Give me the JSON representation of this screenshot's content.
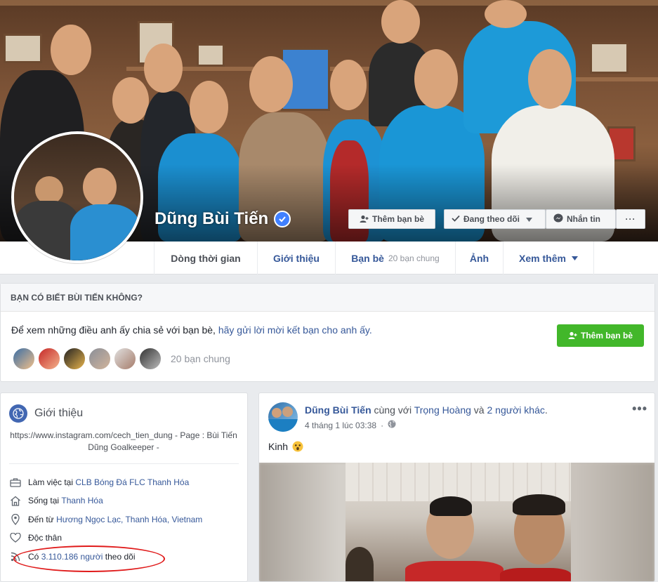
{
  "profile": {
    "name": "Dũng Bùi Tiến"
  },
  "cover_actions": {
    "add_friend": "Thêm bạn bè",
    "following": "Đang theo dõi",
    "message": "Nhắn tin",
    "more": "···"
  },
  "tabs": {
    "timeline": "Dòng thời gian",
    "about": "Giới thiệu",
    "friends": "Bạn bè",
    "friends_sub": "20 bạn chung",
    "photos": "Ảnh",
    "more": "Xem thêm"
  },
  "know_box": {
    "heading": "BẠN CÓ BIẾT BÙI TIẾN KHÔNG?",
    "text": "Để xem những điều anh ấy chia sẻ với bạn bè,",
    "link": "hãy gửi lời mời kết bạn cho anh ấy.",
    "button": "Thêm bạn bè",
    "mutual": "20 bạn chung"
  },
  "intro": {
    "title": "Giới thiệu",
    "bio": "https://www.instagram.com/cech_tien_dung - Page : Bùi Tiến Dũng Goalkeeper -",
    "work_prefix": "Làm việc tại",
    "work_link": "CLB Bóng Đá FLC Thanh Hóa",
    "lives_prefix": "Sống tại",
    "lives_link": "Thanh Hóa",
    "from_prefix": "Đến từ",
    "from_link": "Hương Ngọc Lạc, Thanh Hóa, Vietnam",
    "relationship": "Độc thân",
    "followers_prefix": "Có",
    "followers_link": "3.110.186 người",
    "followers_suffix": "theo dõi"
  },
  "post": {
    "author": "Dũng Bùi Tiến",
    "with": "cùng với",
    "tagged": "Trọng Hoàng",
    "and": "và",
    "others": "2 người khác",
    "date": "4 tháng 1 lúc 03:38",
    "text": "Kinh",
    "more": "•••"
  },
  "colors": {
    "link": "#365899",
    "green_button": "#42b72a",
    "verified": "#4080ff",
    "highlight_oval": "#e01b1b"
  }
}
